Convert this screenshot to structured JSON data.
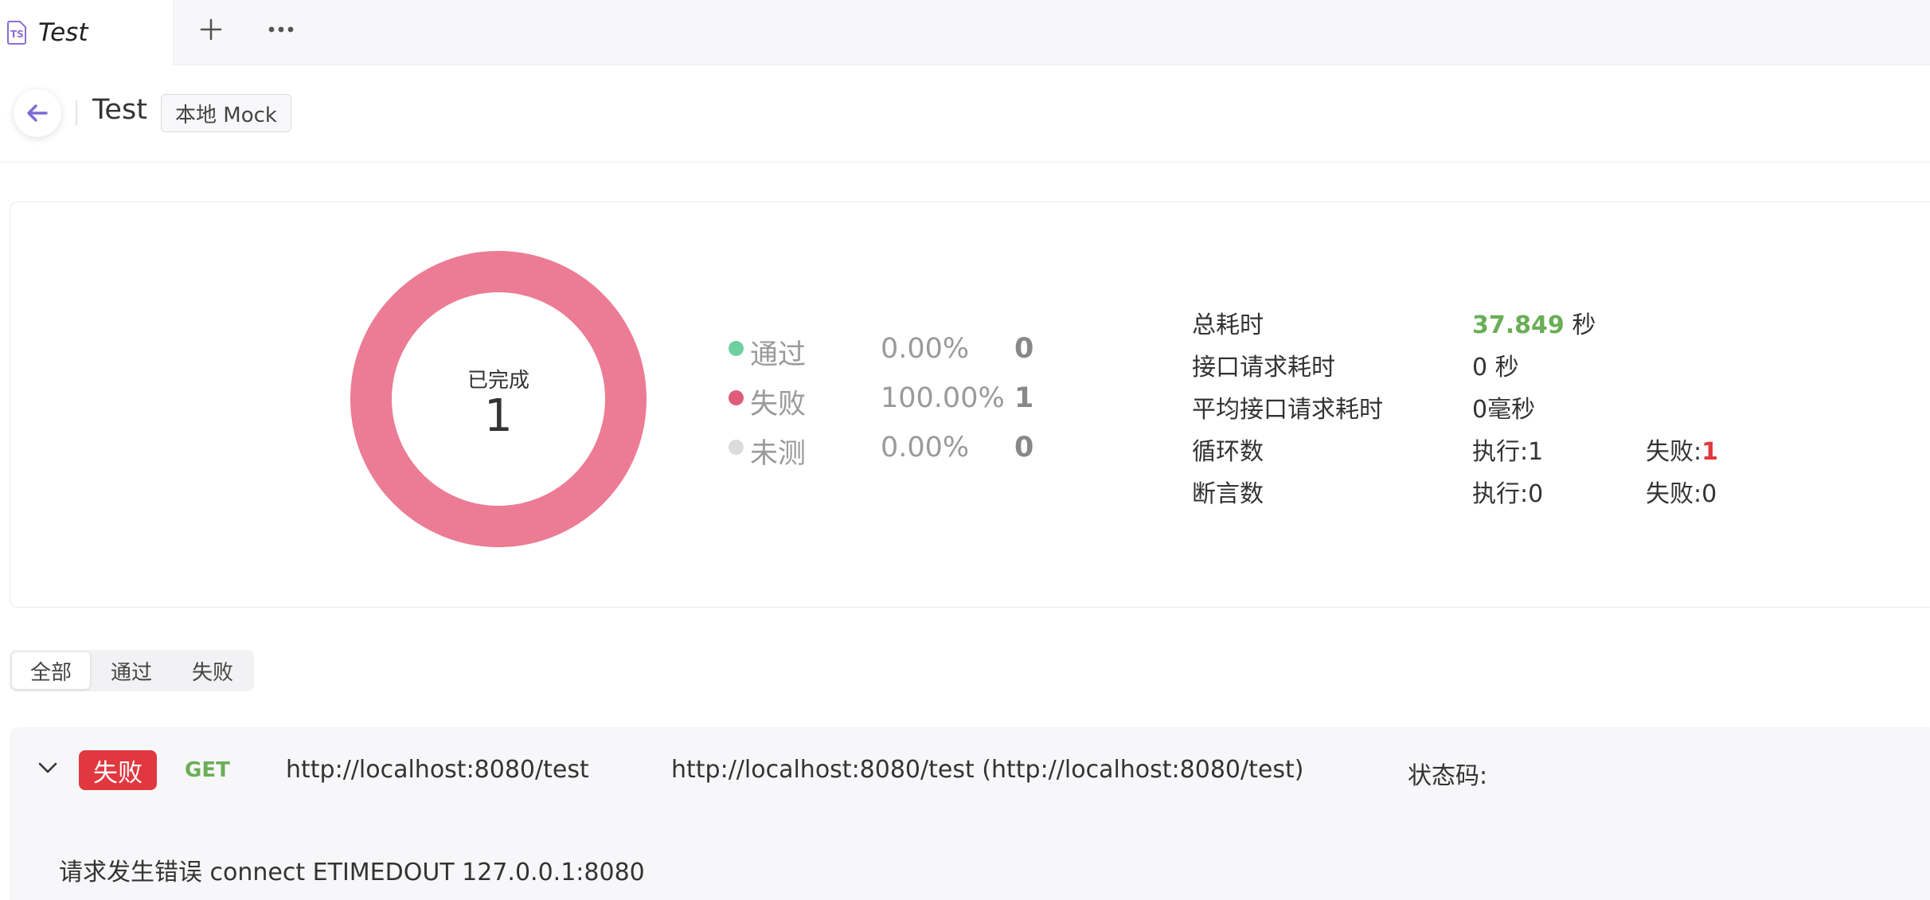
{
  "tabbar": {
    "tab_label": "Test",
    "tab_icon": "typescript-file-icon",
    "add_icon": "plus-icon",
    "more_icon": "more-icon"
  },
  "header": {
    "back_icon": "arrow-left-icon",
    "title": "Test",
    "environment": "本地 Mock"
  },
  "summary": {
    "donut_label": "已完成",
    "donut_count": "1",
    "legend": [
      {
        "name": "通过",
        "percent": "0.00%",
        "count": "0",
        "color": "#6fcf9f"
      },
      {
        "name": "失败",
        "percent": "100.00%",
        "count": "1",
        "color": "#e05d7a"
      },
      {
        "name": "未测",
        "percent": "0.00%",
        "count": "0",
        "color": "#dcdcdc"
      }
    ],
    "donut_color": "#ec7b94",
    "stats": {
      "total_time_label": "总耗时",
      "total_time_value": "37.849",
      "total_time_unit": "秒",
      "request_time_label": "接口请求耗时",
      "request_time_value": "0 秒",
      "avg_request_time_label": "平均接口请求耗时",
      "avg_request_time_value": "0毫秒",
      "loop_label": "循环数",
      "loop_exec": "执行:1",
      "loop_fail_label": "失败:",
      "loop_fail_value": "1",
      "assert_label": "断言数",
      "assert_exec": "执行:0",
      "assert_fail": "失败:0"
    }
  },
  "filters": [
    "全部",
    "通过",
    "失败"
  ],
  "result": {
    "status": "失败",
    "method": "GET",
    "url": "http://localhost:8080/test",
    "full_url": "http://localhost:8080/test (http://localhost:8080/test)",
    "status_code_label": "状态码:",
    "error": "请求发生错误 connect ETIMEDOUT 127.0.0.1:8080",
    "status_color": "#e0383e",
    "method_color": "#6aae57"
  }
}
